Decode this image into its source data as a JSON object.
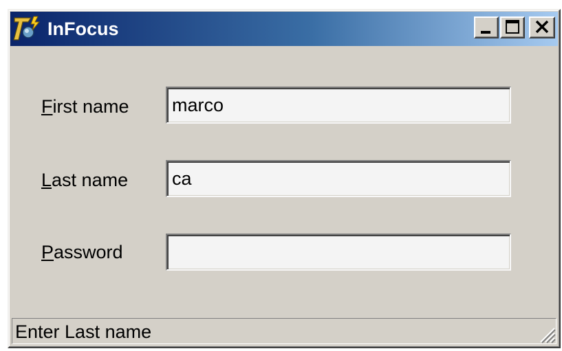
{
  "window": {
    "title": "InFocus",
    "icon": "app-logo-icon",
    "controls": {
      "minimize_icon": "minimize-icon",
      "maximize_icon": "maximize-icon",
      "close_icon": "close-icon"
    }
  },
  "form": {
    "fields": [
      {
        "label_accel": "F",
        "label_rest": "irst name",
        "value": "marco"
      },
      {
        "label_accel": "L",
        "label_rest": "ast name",
        "value": "ca"
      },
      {
        "label_accel": "P",
        "label_rest": "assword",
        "value": ""
      }
    ]
  },
  "status": {
    "text": "Enter Last name"
  },
  "colors": {
    "title_gradient_start": "#0a246a",
    "title_gradient_end": "#a6caf0",
    "face": "#d4d0c8"
  }
}
